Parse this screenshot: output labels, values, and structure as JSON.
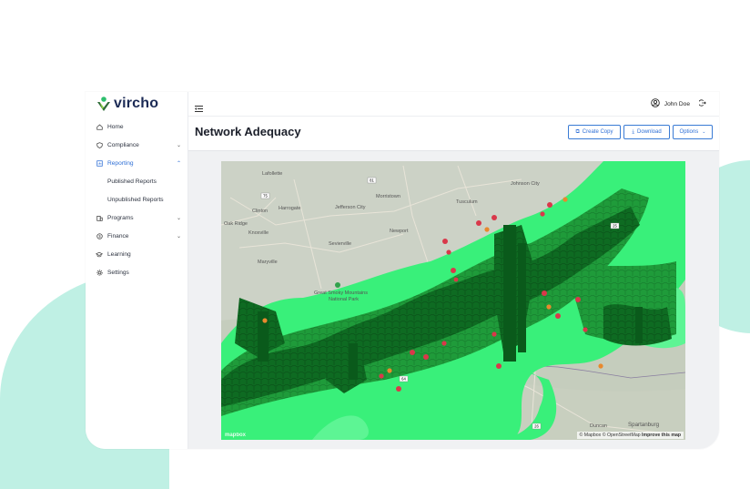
{
  "brand": {
    "name": "vircho"
  },
  "nav": {
    "items": [
      {
        "label": "Home",
        "icon": "home-icon"
      },
      {
        "label": "Compliance",
        "icon": "shield-icon",
        "expandable": true
      },
      {
        "label": "Reporting",
        "icon": "report-icon",
        "expandable": true,
        "expanded": true,
        "active": true
      },
      {
        "label": "Published Reports",
        "sub": true
      },
      {
        "label": "Unpublished Reports",
        "sub": true
      },
      {
        "label": "Programs",
        "icon": "building-icon",
        "expandable": true
      },
      {
        "label": "Finance",
        "icon": "dollar-icon",
        "expandable": true
      },
      {
        "label": "Learning",
        "icon": "graduation-icon"
      },
      {
        "label": "Settings",
        "icon": "gear-icon"
      }
    ]
  },
  "topbar": {
    "user_name": "John Doe"
  },
  "header": {
    "title": "Network Adequacy",
    "create_copy": "Create Copy",
    "download": "Download",
    "options": "Options"
  },
  "map": {
    "labels": {
      "lafollette": "Lafollette",
      "clinton": "Clinton",
      "harrogate": "Harrogate",
      "oak_ridge": "Oak Ridge",
      "knoxville": "Knoxville",
      "maryville": "Maryville",
      "morristown": "Morristown",
      "jefferson_city": "Jefferson City",
      "newport": "Newport",
      "sevierville": "Sevierville",
      "johnson_city": "Johnson City",
      "tusculum": "Tusculum",
      "park_line1": "Great Smoky Mountains",
      "park_line2": "National Park",
      "duncan": "Duncan",
      "spartanburg": "Spartanburg",
      "hwy_75": "75",
      "hwy_81": "81",
      "hwy_26": "26",
      "hwy_25": "25",
      "hwy_64": "64"
    },
    "attribution_mapbox": "© Mapbox",
    "attribution_osm": "© OpenStreetMap",
    "attribution_improve": "Improve this map",
    "mapbox_logo": "mapbox",
    "colors": {
      "base": "#c9d0c2",
      "terrain": "#b9c2b0",
      "light_green": "#39f07a",
      "mid_green": "#22b847",
      "dark_green": "#0e6b22",
      "red_point": "#d9384a",
      "orange_point": "#e8892e"
    }
  }
}
